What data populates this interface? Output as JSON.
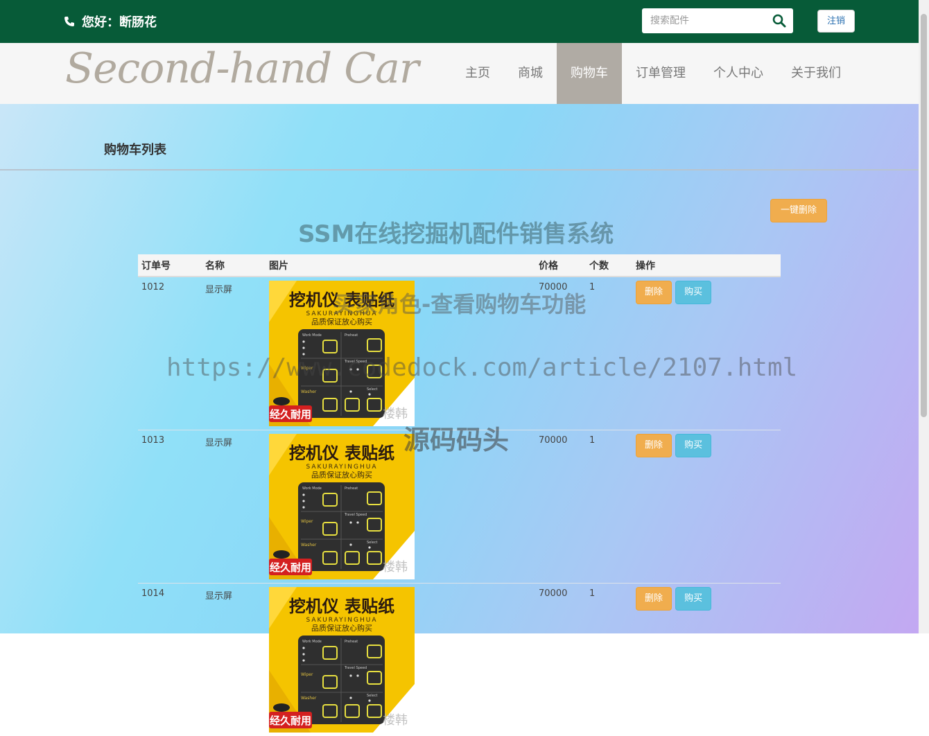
{
  "header": {
    "greeting": "您好：断肠花",
    "search_placeholder": "搜索配件",
    "logout_label": "注销"
  },
  "brand": {
    "logo_text": "Second-hand Car"
  },
  "nav": {
    "items": [
      {
        "label": "主页"
      },
      {
        "label": "商城"
      },
      {
        "label": "购物车"
      },
      {
        "label": "订单管理"
      },
      {
        "label": "个人中心"
      },
      {
        "label": "关于我们"
      }
    ],
    "active": "购物车"
  },
  "page": {
    "section_title": "购物车列表",
    "bulk_delete_label": "一键删除"
  },
  "watermarks": {
    "line1": "SSM在线挖掘机配件销售系统",
    "line2": "买家角色-查看购物车功能",
    "line3": "https://www.codedock.com/article/2107.html",
    "line4": "源码码头"
  },
  "table": {
    "headers": [
      "订单号",
      "名称",
      "图片",
      "价格",
      "个数",
      "操作"
    ],
    "rows": [
      {
        "id": "1012",
        "name": "显示屏",
        "price": "70000",
        "qty": "1"
      },
      {
        "id": "1013",
        "name": "显示屏",
        "price": "70000",
        "qty": "1"
      },
      {
        "id": "1014",
        "name": "显示屏",
        "price": "70000",
        "qty": "1"
      }
    ],
    "delete_label": "删除",
    "buy_label": "购买"
  },
  "product_image": {
    "title": "挖机仪 表贴纸",
    "subtitle": "SAKURAYINGHUA",
    "tagline": "品质保证放心购买",
    "badge": "经久耐用",
    "labels": [
      "Work Mode",
      "Preheat",
      "Travel Speed",
      "Wiper",
      "Select",
      "Washer"
    ],
    "corner_text": "楼韩"
  },
  "colors": {
    "topbar": "#075b38",
    "nav_active": "#b0aba4",
    "warning": "#f0ad4e",
    "info": "#5bc0de",
    "product_yellow": "#f5c400"
  }
}
